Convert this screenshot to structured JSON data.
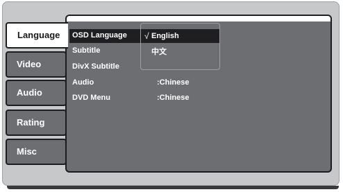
{
  "tabs": [
    {
      "label": "Language",
      "active": true
    },
    {
      "label": "Video",
      "active": false
    },
    {
      "label": "Audio",
      "active": false
    },
    {
      "label": "Rating",
      "active": false
    },
    {
      "label": "Misc",
      "active": false
    }
  ],
  "settings": [
    {
      "label": "OSD Language",
      "value": "",
      "selected": true
    },
    {
      "label": "Subtitle",
      "value": ""
    },
    {
      "label": "DivX Subtitle",
      "value": ""
    },
    {
      "label": "Audio",
      "value": ":Chinese"
    },
    {
      "label": "DVD Menu",
      "value": ":Chinese"
    }
  ],
  "dropdown": {
    "check_mark": "√",
    "options": [
      {
        "label": "English",
        "selected": true
      },
      {
        "label": "中文",
        "selected": false
      }
    ]
  },
  "colors": {
    "frame": "#c7c8ca",
    "panel": "#6d6e71",
    "highlight": "#1f1f21",
    "text": "#ffffff"
  }
}
